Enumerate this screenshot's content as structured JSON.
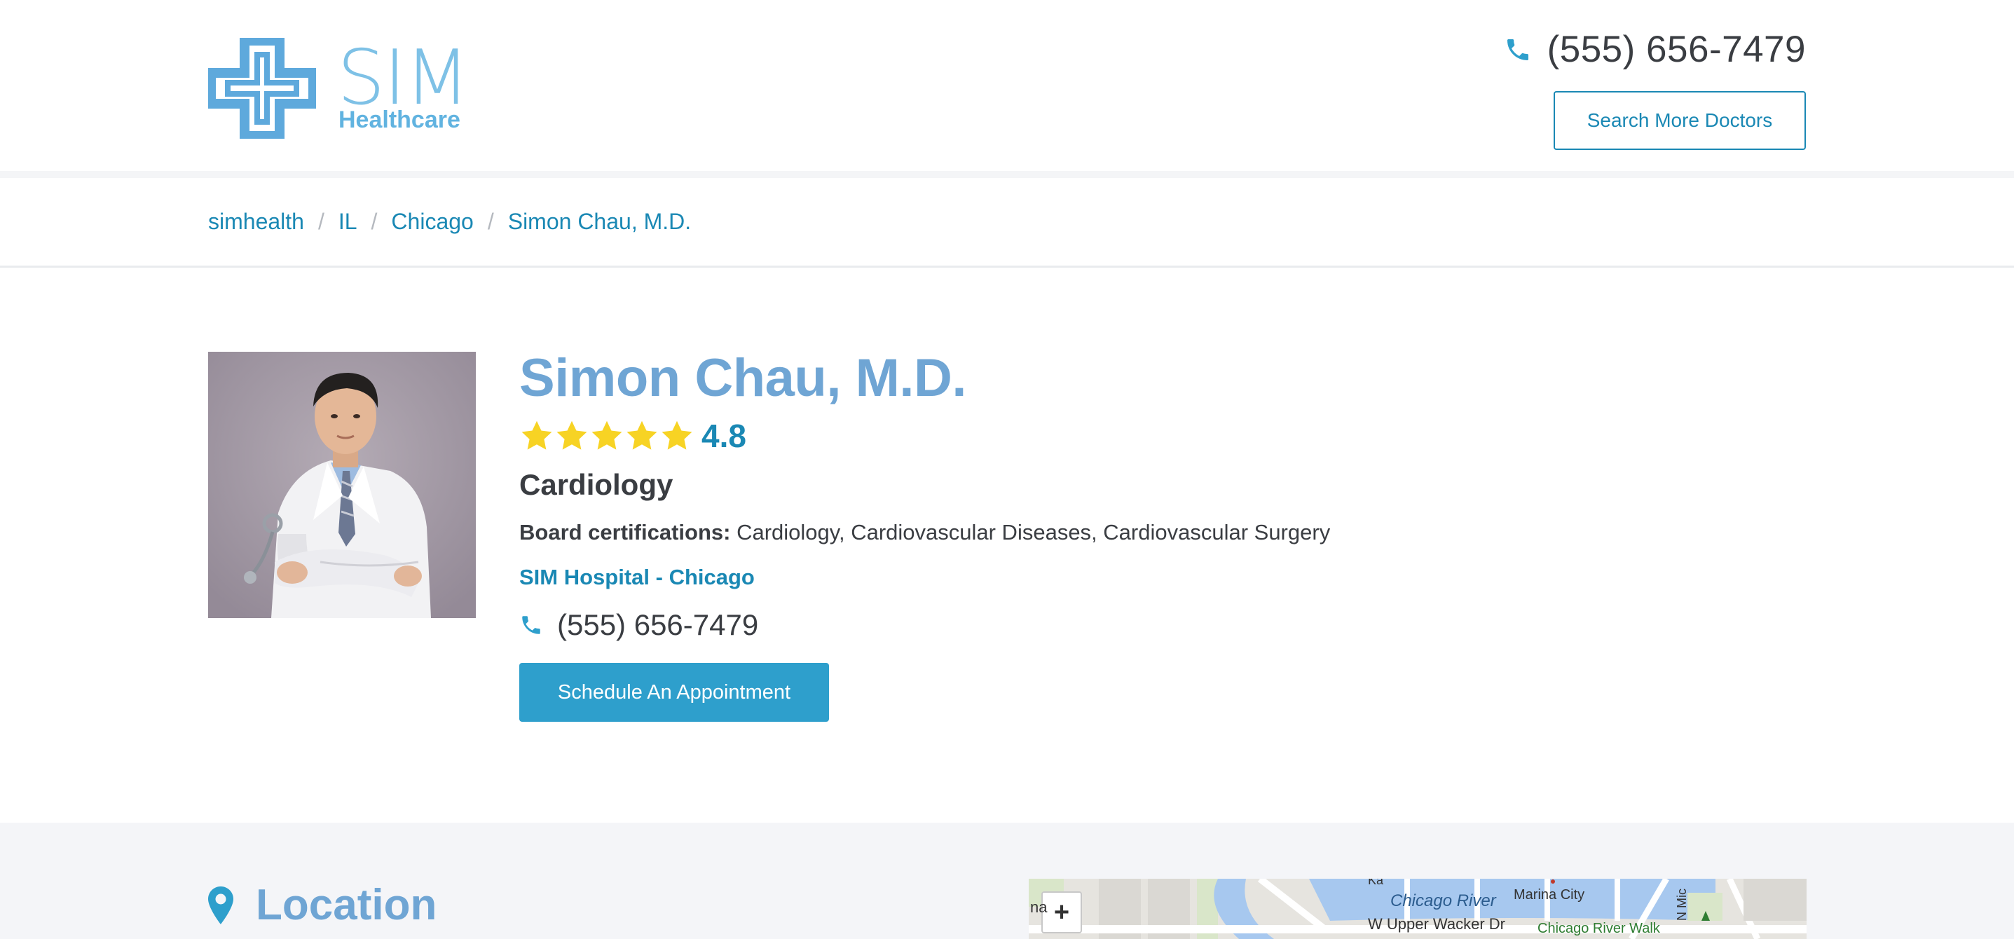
{
  "header": {
    "logo": {
      "name": "SIM",
      "subtitle": "Healthcare"
    },
    "phone": "(555) 656-7479",
    "search_button": "Search More Doctors"
  },
  "breadcrumb": [
    "simhealth",
    "IL",
    "Chicago",
    "Simon Chau, M.D."
  ],
  "doctor": {
    "name": "Simon Chau, M.D.",
    "rating": "4.8",
    "rating_stars": 5,
    "specialty": "Cardiology",
    "board_cert_label": "Board certifications:",
    "board_certs": "Cardiology, Cardiovascular Diseases, Cardiovascular Surgery",
    "hospital": "SIM Hospital - Chicago",
    "phone": "(555) 656-7479",
    "schedule_button": "Schedule An Appointment"
  },
  "location": {
    "title": "Location",
    "map": {
      "zoom_in": "+",
      "labels": {
        "river": "Chicago River",
        "marina": "Marina City",
        "wacker": "W Upper Wacker Dr",
        "riverwalk": "Chicago River Walk",
        "nmich": "N Mic",
        "edge_left": "na",
        "edge_top": "Ka"
      }
    }
  },
  "colors": {
    "brand_blue": "#6fa5d4",
    "link_blue": "#1a88b4",
    "button_blue": "#2e9fcc",
    "star_yellow": "#f7d324"
  }
}
